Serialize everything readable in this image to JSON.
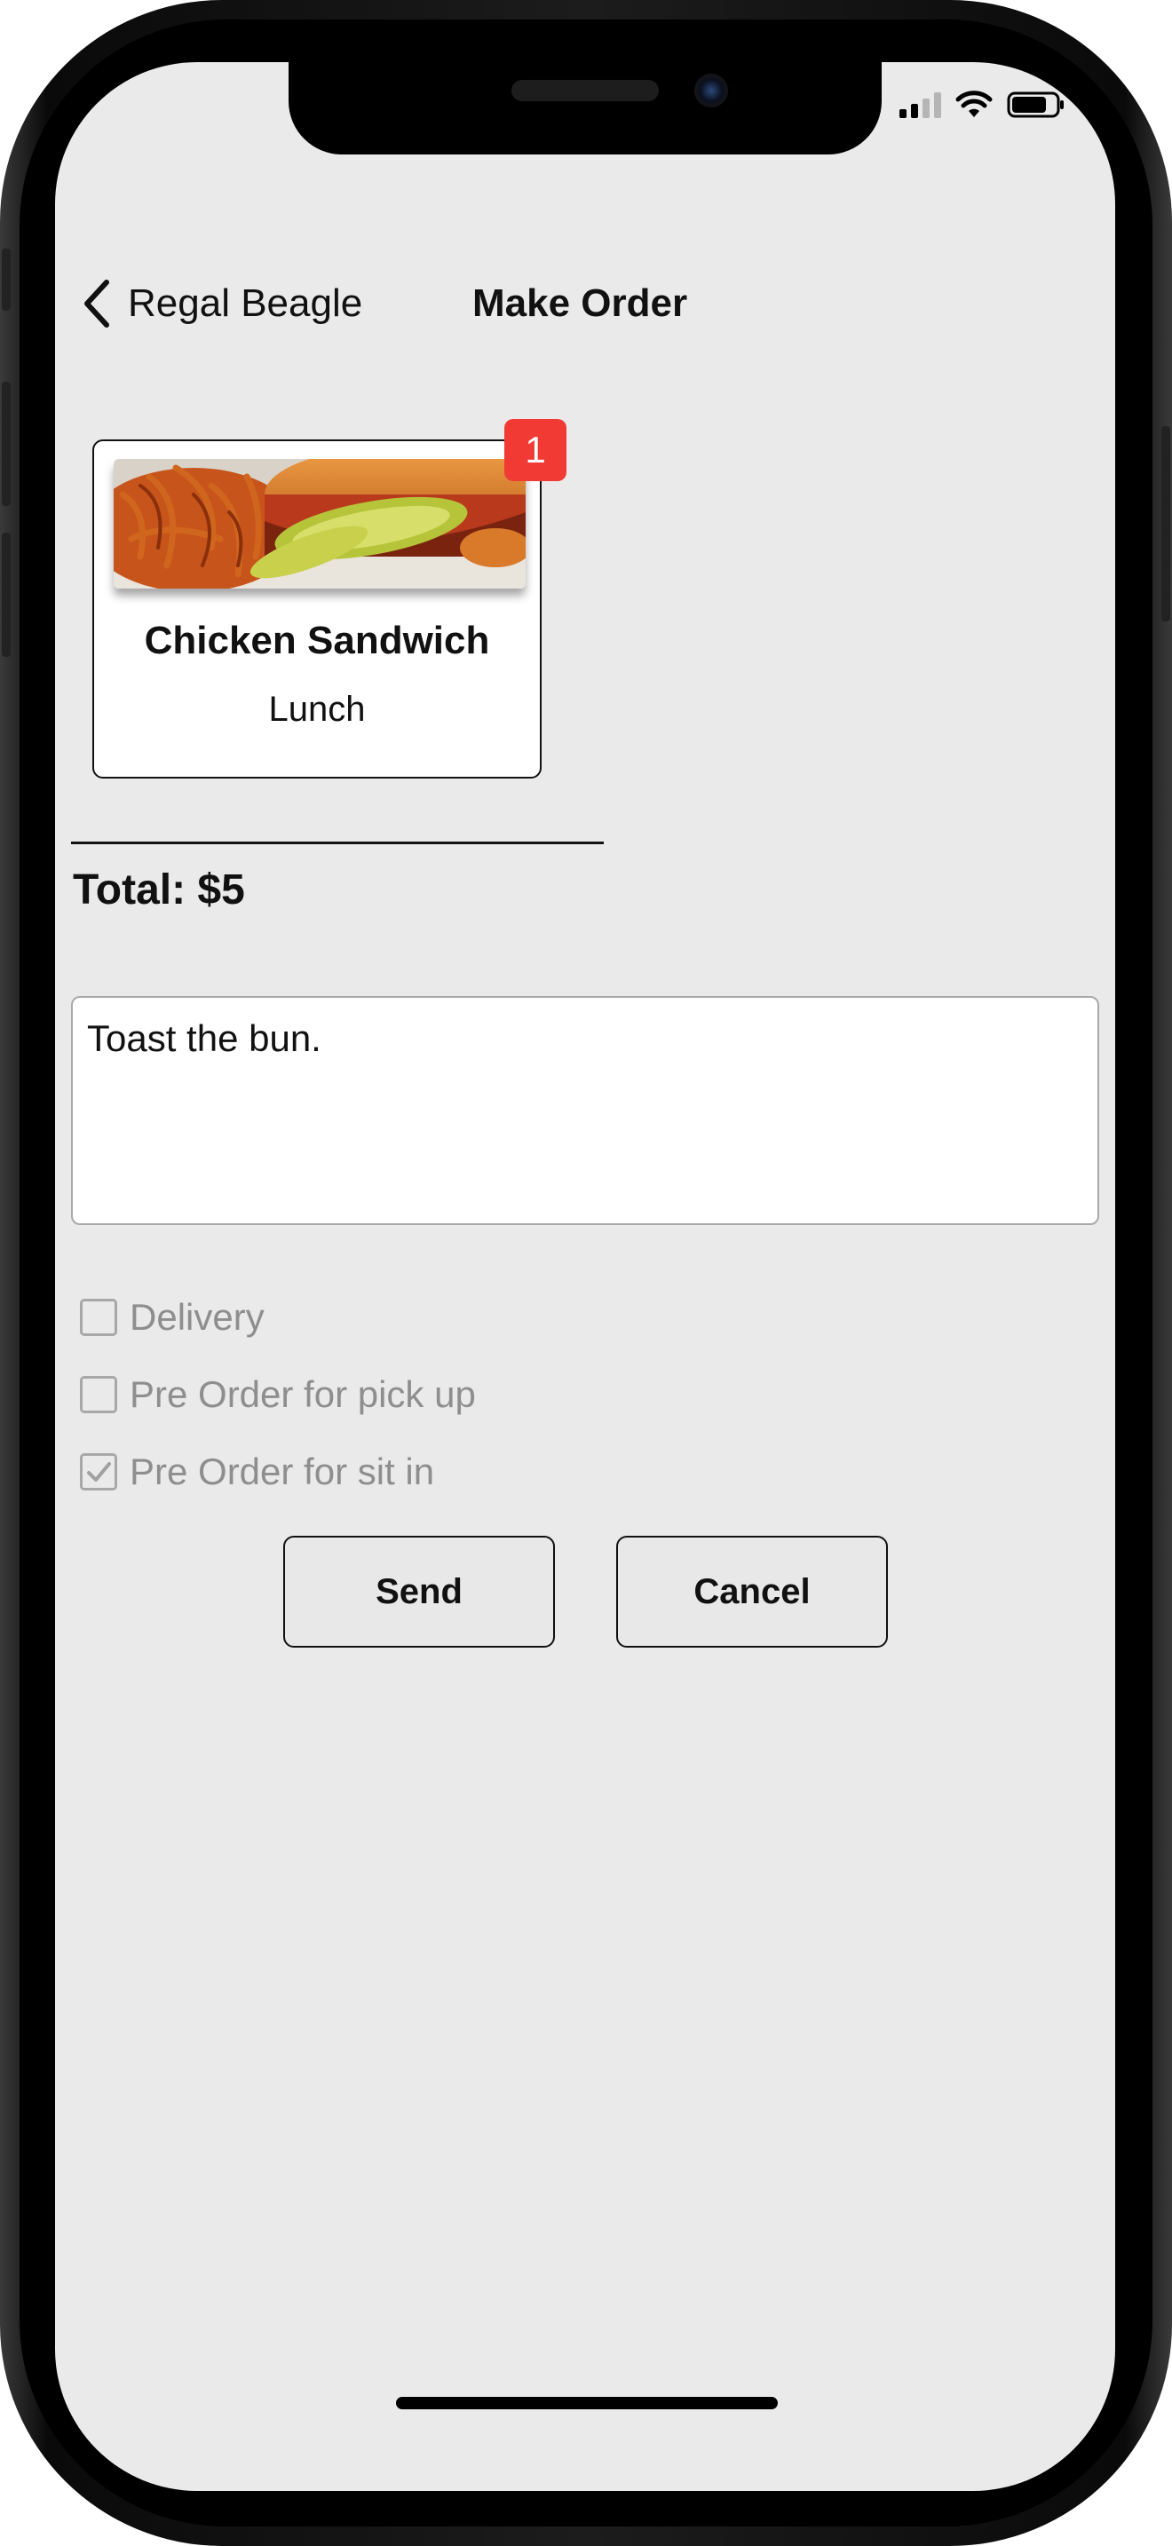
{
  "nav": {
    "back_label": "Regal Beagle",
    "title": "Make Order"
  },
  "item": {
    "name": "Chicken Sandwich",
    "category": "Lunch",
    "quantity_badge": "1"
  },
  "total": {
    "label": "Total: $5"
  },
  "notes": {
    "value": "Toast the bun."
  },
  "options": [
    {
      "label": "Delivery",
      "checked": false
    },
    {
      "label": "Pre Order for pick up",
      "checked": false
    },
    {
      "label": "Pre Order for sit in",
      "checked": true
    }
  ],
  "actions": {
    "send_label": "Send",
    "cancel_label": "Cancel"
  },
  "colors": {
    "badge": "#f03a33",
    "screen_bg": "#eaeaea",
    "muted_text": "#8e8e8e"
  }
}
